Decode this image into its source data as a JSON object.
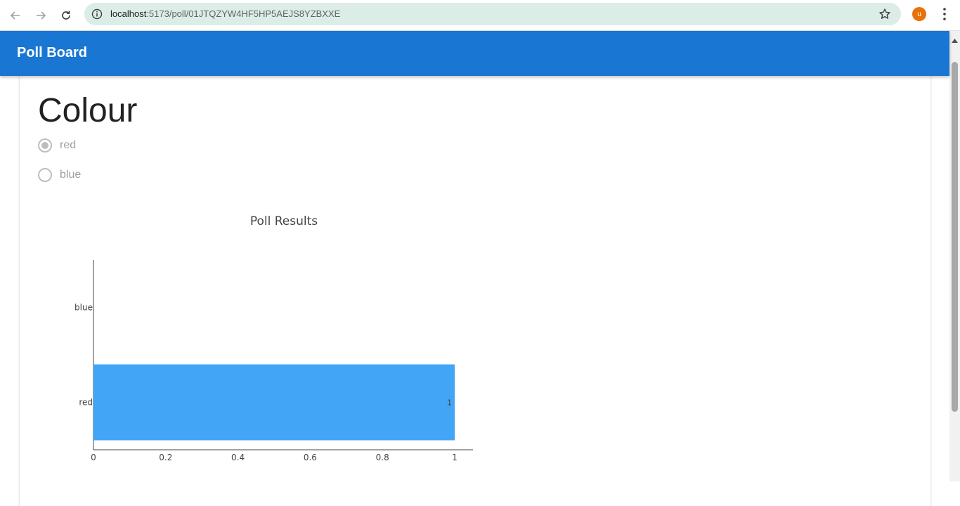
{
  "browser": {
    "url_host": "localhost",
    "url_rest": ":5173/poll/01JTQZYW4HF5HP5AEJS8YZBXXE",
    "profile_initial": "u"
  },
  "app": {
    "title": "Poll Board"
  },
  "poll": {
    "question": "Colour",
    "options": [
      {
        "label": "red",
        "selected": true
      },
      {
        "label": "blue",
        "selected": false
      }
    ]
  },
  "colors": {
    "app_bar": "#1976d2",
    "bar_fill": "#42a5f5"
  },
  "chart_data": {
    "type": "bar",
    "orientation": "horizontal",
    "title": "Poll Results",
    "categories": [
      "red",
      "blue"
    ],
    "values": [
      1,
      0
    ],
    "data_labels": [
      "1",
      ""
    ],
    "xlim": [
      0,
      1
    ],
    "xticks": [
      "0",
      "0.2",
      "0.4",
      "0.6",
      "0.8",
      "1"
    ],
    "xlabel": "",
    "ylabel": "",
    "grid": false
  }
}
